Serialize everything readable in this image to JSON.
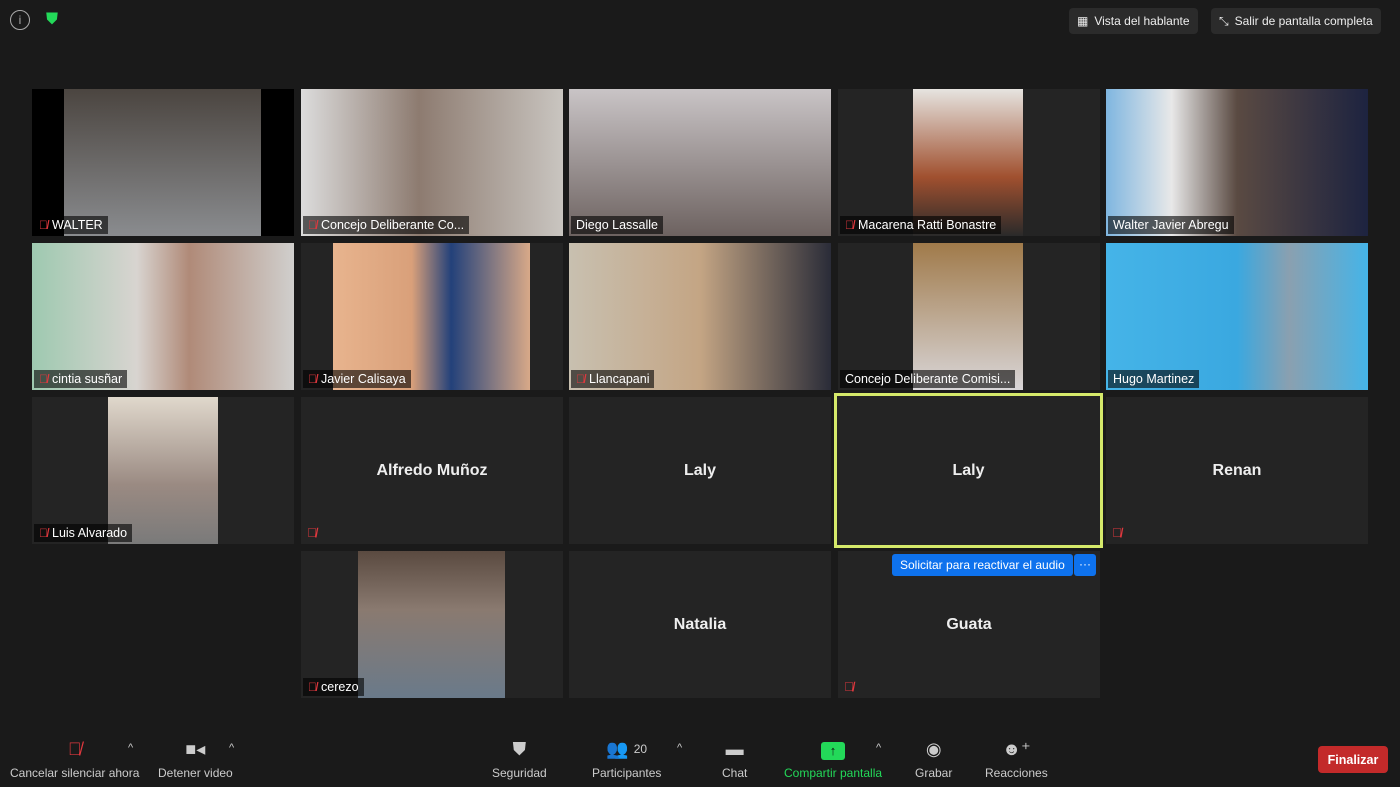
{
  "top": {
    "info_icon": "info-icon",
    "security_icon": "shield-check-icon",
    "speaker_view": "Vista del hablante",
    "exit_fullscreen": "Salir de pantalla completa"
  },
  "tiles": [
    {
      "name": "WALTER",
      "muted": true
    },
    {
      "name": "Concejo Deliberante Co...",
      "muted": true
    },
    {
      "name": "Diego Lassalle",
      "muted": false
    },
    {
      "name": "Macarena Ratti Bonastre",
      "muted": true
    },
    {
      "name": "Walter Javier Abregu",
      "muted": false
    },
    {
      "name": "cintia susñar",
      "muted": true
    },
    {
      "name": "Javier Calisaya",
      "muted": true
    },
    {
      "name": "Llancapani",
      "muted": true
    },
    {
      "name": "Concejo Deliberante Comisi...",
      "muted": false
    },
    {
      "name": "Hugo Martinez",
      "muted": false
    },
    {
      "name": "Luis Alvarado",
      "muted": true
    },
    {
      "name": "Alfredo Muñoz",
      "muted": true
    },
    {
      "name": "Laly",
      "muted": false
    },
    {
      "name": "Laly",
      "muted": false,
      "active_speaker": true
    },
    {
      "name": "Renan",
      "muted": true
    },
    {
      "name": "cerezo",
      "muted": true
    },
    {
      "name": "Natalia",
      "muted": false
    },
    {
      "name": "Guata",
      "muted": true
    }
  ],
  "request_unmute": "Solicitar para reactivar el audio",
  "more": "···",
  "toolbar": {
    "unmute": "Cancelar silenciar ahora",
    "video": "Detener video",
    "security": "Seguridad",
    "participants": "Participantes",
    "participants_count": "20",
    "chat": "Chat",
    "share": "Compartir pantalla",
    "record": "Grabar",
    "reactions": "Reacciones",
    "end": "Finalizar"
  },
  "colors": {
    "accent": "#0e72ed",
    "share": "#23d959",
    "end": "#c32a2a",
    "active_border": "#d5e96a",
    "muted": "#e0383e"
  }
}
